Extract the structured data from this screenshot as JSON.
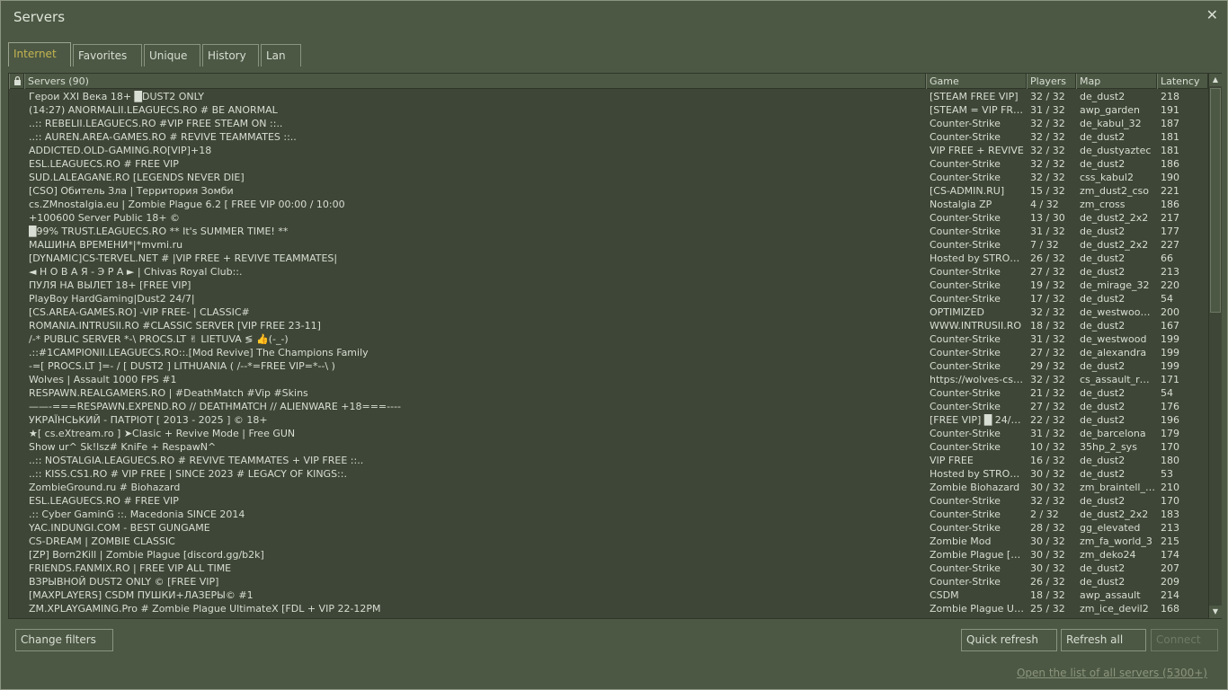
{
  "window": {
    "title": "Servers",
    "close_glyph": "✕"
  },
  "tabs": [
    {
      "label": "Internet",
      "active": true
    },
    {
      "label": "Favorites",
      "active": false
    },
    {
      "label": "Unique",
      "active": false
    },
    {
      "label": "History",
      "active": false
    },
    {
      "label": "Lan",
      "active": false
    }
  ],
  "columns": {
    "lock_icon": "lock-icon",
    "servers": "Servers (90)",
    "game": "Game",
    "players": "Players",
    "map": "Map",
    "latency": "Latency"
  },
  "rows": [
    {
      "name": "Герои XXI Века 18+  █DUST2 ONLY",
      "game": "[STEAM FREE VIP]",
      "players": "32 / 32",
      "map": "de_dust2",
      "latency": "218"
    },
    {
      "name": "(14:27) ANORMALII.LEAGUECS.RO # BE ANORMAL",
      "game": "[STEAM = VIP FREE]",
      "players": "31 / 32",
      "map": "awp_garden",
      "latency": "191"
    },
    {
      "name": "..:: REBELII.LEAGUECS.RO #VIP FREE STEAM ON ::..",
      "game": "Counter-Strike",
      "players": "32 / 32",
      "map": "de_kabul_32",
      "latency": "187"
    },
    {
      "name": "..:: AUREN.AREA-GAMES.RO # REVIVE TEAMMATES ::..",
      "game": "Counter-Strike",
      "players": "32 / 32",
      "map": "de_dust2",
      "latency": "181"
    },
    {
      "name": "ADDICTED.OLD-GAMING.RO[VIP]+18",
      "game": "VIP FREE + REVIVE",
      "players": "32 / 32",
      "map": "de_dustyaztec",
      "latency": "181"
    },
    {
      "name": "ESL.LEAGUECS.RO # FREE VIP",
      "game": "Counter-Strike",
      "players": "32 / 32",
      "map": "de_dust2",
      "latency": "186"
    },
    {
      "name": "SUD.LALEAGANE.RO [LEGENDS NEVER DIE]",
      "game": "Counter-Strike",
      "players": "32 / 32",
      "map": "css_kabul2",
      "latency": "190"
    },
    {
      "name": "[CSO] Обитель Зла | Территория Зомби",
      "game": "[CS-ADMIN.RU]",
      "players": "15 / 32",
      "map": "zm_dust2_cso",
      "latency": "221"
    },
    {
      "name": "cs.ZMnostalgia.eu | Zombie Plague 6.2 [ FREE VIP 00:00 / 10:00",
      "game": "Nostalgia ZP",
      "players": "4 / 32",
      "map": "zm_cross",
      "latency": "186"
    },
    {
      "name": "+100600 Server Public 18+ ©",
      "game": "Counter-Strike",
      "players": "13 / 30",
      "map": "de_dust2_2x2",
      "latency": "217"
    },
    {
      "name": "█99%  TRUST.LEAGUECS.RO  ** It's SUMMER TIME! **",
      "game": "Counter-Strike",
      "players": "31 / 32",
      "map": "de_dust2",
      "latency": "177"
    },
    {
      "name": "МАШИНА ВРЕМЕНИ*|*mvmi.ru",
      "game": "Counter-Strike",
      "players": "7 / 32",
      "map": "de_dust2_2x2",
      "latency": "227"
    },
    {
      "name": "[DYNAMIC]CS-TERVEL.NET # |VIP FREE + REVIVE TEAMMATES|",
      "game": "Hosted by STRONG...",
      "players": "26 / 32",
      "map": "de_dust2",
      "latency": "66"
    },
    {
      "name": "◄ Н О В А Я - Э Р А ► | Chivas Royal Club::.",
      "game": "Counter-Strike",
      "players": "27 / 32",
      "map": "de_dust2",
      "latency": "213"
    },
    {
      "name": "ПУЛЯ НА ВЫЛЕТ 18+ [FREE VIP]",
      "game": "Counter-Strike",
      "players": "19 / 32",
      "map": "de_mirage_32",
      "latency": "220"
    },
    {
      "name": "PlayBoy HardGaming|Dust2 24/7|",
      "game": "Counter-Strike",
      "players": "17 / 32",
      "map": "de_dust2",
      "latency": "54"
    },
    {
      "name": "[CS.AREA-GAMES.RO] -VIP FREE- | CLASSIC#",
      "game": "OPTIMIZED",
      "players": "32 / 32",
      "map": "de_westwood_...",
      "latency": "200"
    },
    {
      "name": "ROMANIA.INTRUSII.RO #CLASSIC SERVER [VIP FREE 23-11]",
      "game": "WWW.INTRUSII.RO",
      "players": "18 / 32",
      "map": "de_dust2",
      "latency": "167"
    },
    {
      "name": "/-* PUBLIC SERVER *-\\ PROCS.LT ✌ LIETUVA ≶ 👍(-_-)",
      "game": "Counter-Strike",
      "players": "31 / 32",
      "map": "de_westwood",
      "latency": "199"
    },
    {
      "name": ".::#1CAMPIONII.LEAGUECS.RO::.[Mod Revive] The Champions Family",
      "game": "Counter-Strike",
      "players": "27 / 32",
      "map": "de_alexandra",
      "latency": "199"
    },
    {
      "name": "-=[ PROCS.LT ]=- / [ DUST2 ] LITHUANIA ( /--*=FREE VIP=*--\\ )",
      "game": "Counter-Strike",
      "players": "29 / 32",
      "map": "de_dust2",
      "latency": "199"
    },
    {
      "name": "Wolves | Assault 1000 FPS #1",
      "game": "https://wolves-cs.com",
      "players": "32 / 32",
      "map": "cs_assault_rush2",
      "latency": "171"
    },
    {
      "name": "RESPAWN.REALGAMERS.RO | #DeathMatch #Vip #Skins",
      "game": "Counter-Strike",
      "players": "21 / 32",
      "map": "de_dust2",
      "latency": "54"
    },
    {
      "name": "——-===RESPAWN.EXPEND.RO // DEATHMATCH // ALIENWARE +18===----",
      "game": "Counter-Strike",
      "players": "27 / 32",
      "map": "de_dust2",
      "latency": "176"
    },
    {
      "name": "УКРАЇНСЬКИЙ - ПАТРІОТ [ 2013 - 2025 ] © 18+",
      "game": "[FREE VIP] █ 24/7 █",
      "players": "22 / 32",
      "map": "de_dust2",
      "latency": "196"
    },
    {
      "name": "★[ cs.eXtream.ro ] ➤Clasic + Revive Mode | Free GUN",
      "game": "Counter-Strike",
      "players": "31 / 32",
      "map": "de_barcelona",
      "latency": "179"
    },
    {
      "name": "Show ur^ Sk!lsz# KniFe + RespawN^",
      "game": "Counter-Strike",
      "players": "10 / 32",
      "map": "35hp_2_sys",
      "latency": "170"
    },
    {
      "name": "..:: NOSTALGIA.LEAGUECS.RO # REVIVE TEAMMATES + VIP FREE ::..",
      "game": "VIP FREE",
      "players": "16 / 32",
      "map": "de_dust2",
      "latency": "180"
    },
    {
      "name": "..:: KISS.CS1.RO # VIP FREE | SINCE 2023 # LEGACY OF KINGS::.",
      "game": "Hosted by STRONG...",
      "players": "30 / 32",
      "map": "de_dust2",
      "latency": "53"
    },
    {
      "name": "ZombieGround.ru # Biohazard",
      "game": "Zombie Biohazard",
      "players": "30 / 32",
      "map": "zm_braintell_ja...",
      "latency": "210"
    },
    {
      "name": "ESL.LEAGUECS.RO # FREE VIP",
      "game": "Counter-Strike",
      "players": "32 / 32",
      "map": "de_dust2",
      "latency": "170"
    },
    {
      "name": ".:: Cyber GaminG ::. Macedonia  SINCE 2014",
      "game": "Counter-Strike",
      "players": "2 / 32",
      "map": "de_dust2_2x2",
      "latency": "183"
    },
    {
      "name": "YAC.INDUNGI.COM - BEST GUNGAME",
      "game": "Counter-Strike",
      "players": "28 / 32",
      "map": "gg_elevated",
      "latency": "213"
    },
    {
      "name": "CS-DREAM | ZOMBIE CLASSIC",
      "game": "Zombie Mod",
      "players": "30 / 32",
      "map": "zm_fa_world_3",
      "latency": "215"
    },
    {
      "name": "[ZP] Born2Kill | Zombie Plague [discord.gg/b2k]",
      "game": "Zombie Plague [B2K]",
      "players": "30 / 32",
      "map": "zm_deko24",
      "latency": "174"
    },
    {
      "name": "FRIENDS.FANMIX.RO | FREE VIP ALL TIME",
      "game": "Counter-Strike",
      "players": "30 / 32",
      "map": "de_dust2",
      "latency": "207"
    },
    {
      "name": "ВЗРЫВНОЙ DUST2 ONLY © [FREE VIP]",
      "game": "Counter-Strike",
      "players": "26 / 32",
      "map": "de_dust2",
      "latency": "209"
    },
    {
      "name": "[MAXPLAYERS] CSDM ПУШКИ+ЛАЗЕРЫ© #1",
      "game": "CSDM",
      "players": "18 / 32",
      "map": "awp_assault",
      "latency": "214"
    },
    {
      "name": "ZM.XPLAYGAMING.Pro # Zombie Plague UltimateX [FDL + VIP 22-12PM",
      "game": "Zombie Plague Ultim...",
      "players": "25 / 32",
      "map": "zm_ice_devil2",
      "latency": "168"
    }
  ],
  "buttons": {
    "change_filters": "Change filters",
    "quick_refresh": "Quick refresh",
    "refresh_all": "Refresh all",
    "connect": "Connect"
  },
  "footer": {
    "link": "Open the list of all servers (5300+)"
  },
  "colors": {
    "background": "#4c5844",
    "list_bg": "#3e4637",
    "active_tab": "#c4b550"
  }
}
